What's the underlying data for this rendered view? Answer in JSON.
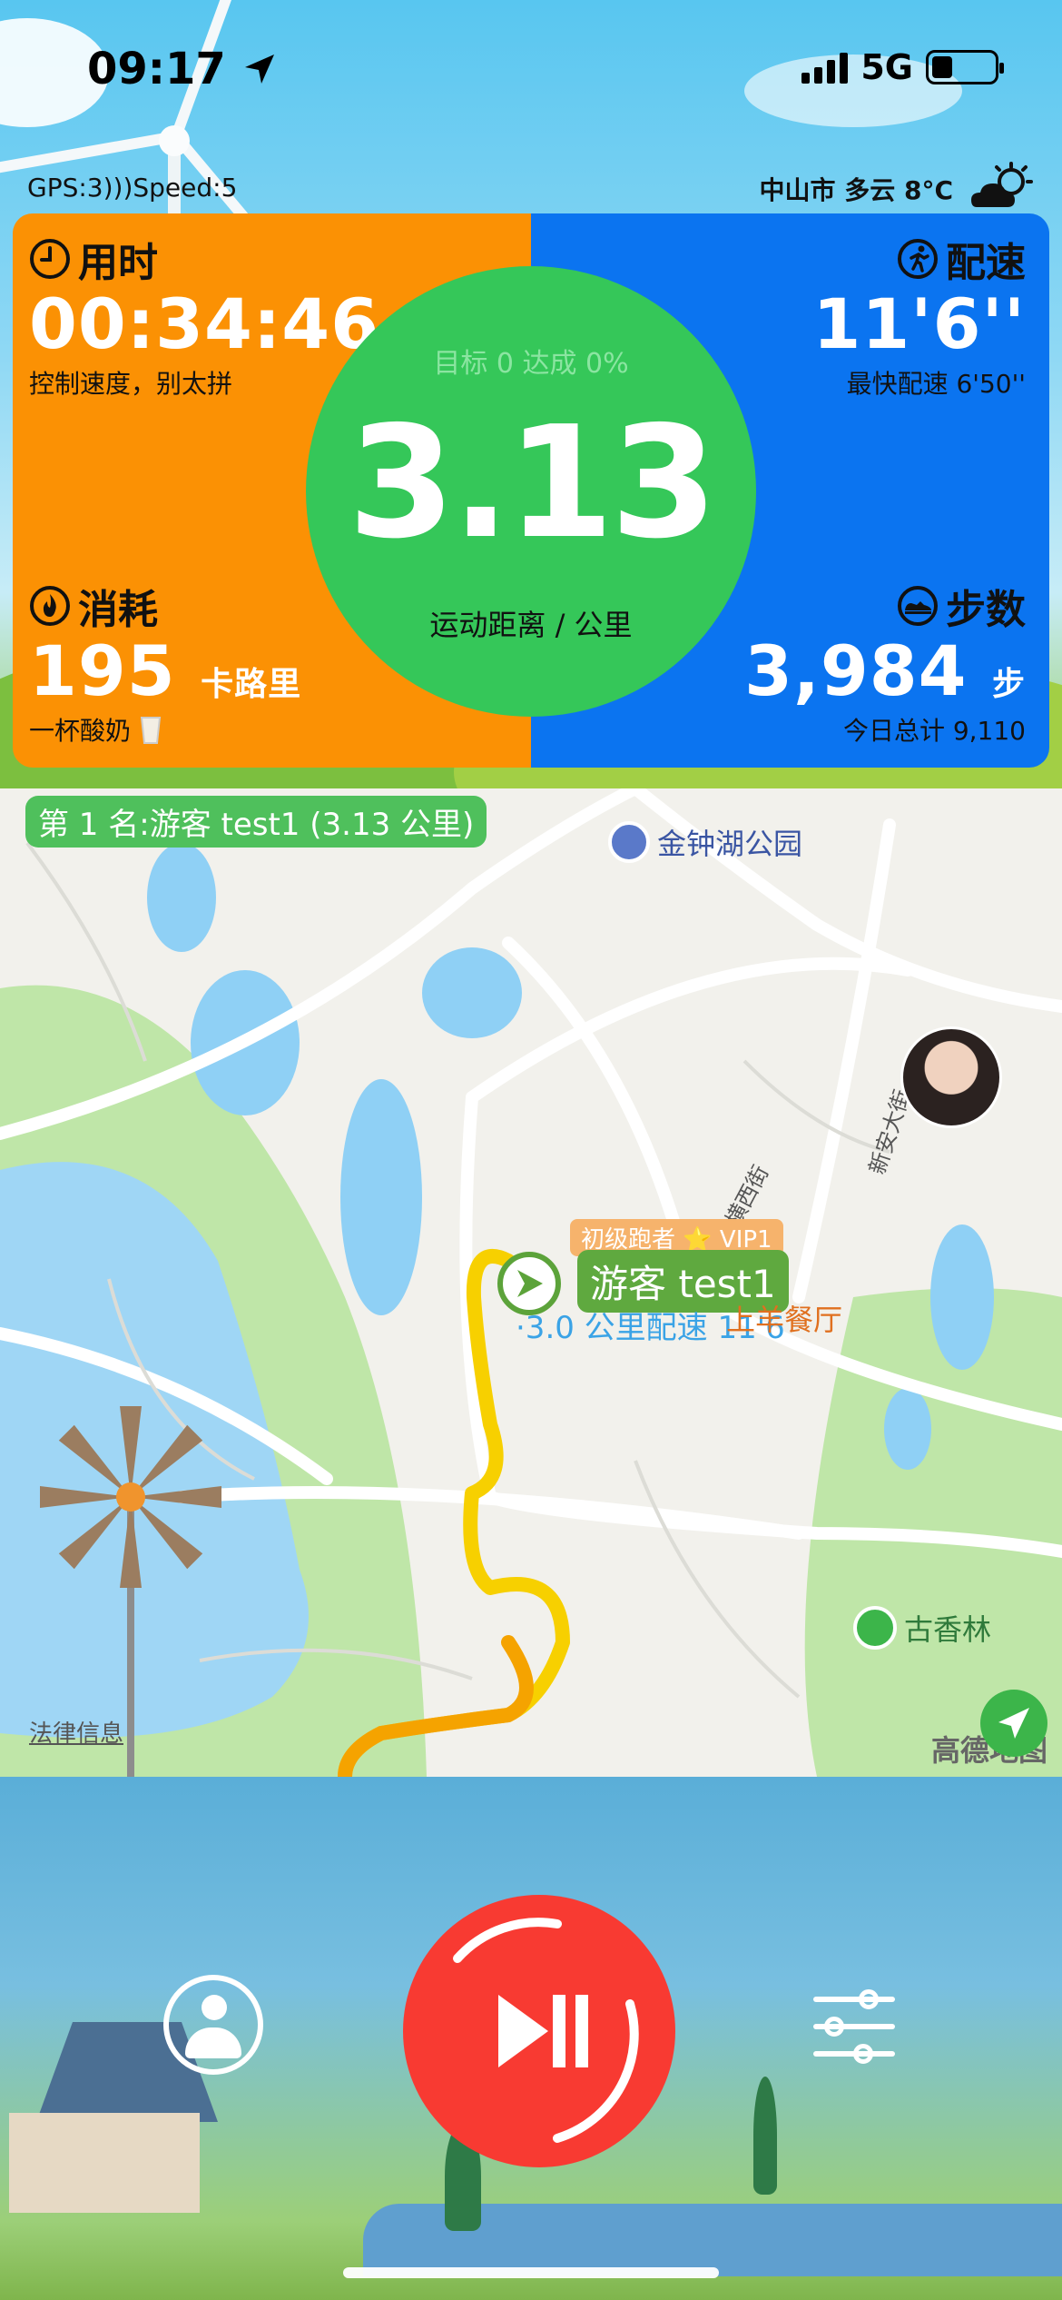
{
  "status_bar": {
    "time": "09:17",
    "network": "5G"
  },
  "header": {
    "gps_speed": "GPS:3)))Speed:5",
    "weather": "中山市 多云 8°C"
  },
  "stats": {
    "time": {
      "label": "用时",
      "value": "00:34:46",
      "sub": "控制速度，别太拼"
    },
    "pace": {
      "label": "配速",
      "value": "11'6''",
      "sub": "最快配速 6'50''"
    },
    "calories": {
      "label": "消耗",
      "value": "195",
      "unit": "卡路里",
      "sub": "一杯酸奶"
    },
    "steps": {
      "label": "步数",
      "value": "3,984",
      "unit": "步",
      "sub": "今日总计 9,110"
    },
    "distance": {
      "target": "目标 0 达成 0%",
      "value": "3.13",
      "label": "运动距离 / 公里"
    }
  },
  "map": {
    "rank": "第 1 名:游客 test1 (3.13 公里)",
    "poi_park": "金钟湖公园",
    "street1": "新安大街",
    "street2": "横西街",
    "runner_tag": "初级跑者 ⭐ VIP1",
    "runner_name": "游客 test1",
    "runner_pace": "·3.0 公里配速 11'6",
    "restaurant": "上羊餐厅",
    "legal": "法律信息",
    "poi_green": "古香林",
    "amap": "高德地图"
  },
  "colors": {
    "orange": "#fb9104",
    "blue": "#0b74f0",
    "green": "#35c759",
    "red": "#f83a32"
  }
}
